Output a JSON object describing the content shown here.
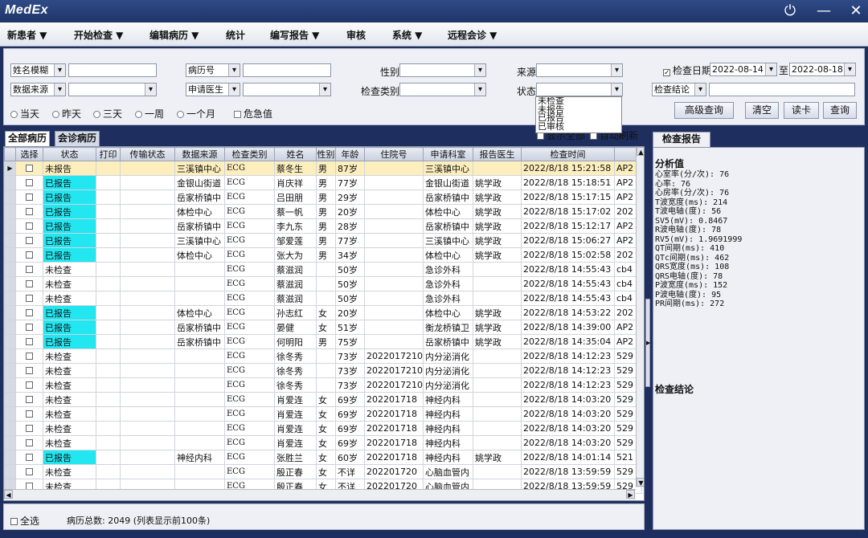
{
  "app": {
    "logo": "MedEx"
  },
  "window_controls": {
    "power": "⏻",
    "minimize": "—",
    "close": "✕"
  },
  "menu": [
    "新患者 ▼",
    "开始检查 ▼",
    "编辑病历 ▼",
    "统计",
    "编写报告 ▼",
    "审核",
    "系统 ▼",
    "远程会诊 ▼"
  ],
  "filters": {
    "name_mode": "姓名模糊",
    "record_no": "病历号",
    "gender": "性别",
    "source": "来源",
    "exam_date_label": "检查日期",
    "exam_date_checked": "✓",
    "date_from": "2022-08-14",
    "to": "至",
    "date_to": "2022-08-18",
    "data_source": "数据来源",
    "applying_doctor": "申请医生",
    "exam_type": "检查类别",
    "status": "状态",
    "conclusion": "检查结论",
    "ranges": [
      "当天",
      "昨天",
      "三天",
      "一周",
      "一个月"
    ],
    "critical": "危急值",
    "status_options": [
      "未检查",
      "未报告",
      "已报告",
      "已审核"
    ]
  },
  "buttons": {
    "advanced": "高级查询",
    "clear": "清空",
    "read_card": "读卡",
    "query": "查询"
  },
  "tabs": {
    "all": "全部病历",
    "consult": "会诊病历",
    "show_all": "显示全部",
    "auto_refresh": "自动刷新"
  },
  "columns": [
    "选择",
    "状态",
    "打印",
    "传输状态",
    "数据来源",
    "检查类别",
    "姓名",
    "性别",
    "年龄",
    "住院号",
    "申请科室",
    "报告医生",
    "检查时间",
    ""
  ],
  "rows": [
    [
      "未报告",
      "三溪镇中心",
      "ECG",
      "蔡冬生",
      "男",
      "87岁",
      "",
      "三溪镇中心",
      "",
      "2022/8/18 15:21:58",
      "AP2"
    ],
    [
      "已报告",
      "金银山街道",
      "ECG",
      "肖庆祥",
      "男",
      "77岁",
      "",
      "金银山街道",
      "姚学政",
      "2022/8/18 15:18:51",
      "AP2"
    ],
    [
      "已报告",
      "岳家桥镇中",
      "ECG",
      "吕田朋",
      "男",
      "29岁",
      "",
      "岳家桥镇中",
      "姚学政",
      "2022/8/18 15:17:15",
      "AP2"
    ],
    [
      "已报告",
      "体检中心",
      "ECG",
      "蔡一帆",
      "男",
      "20岁",
      "",
      "体检中心",
      "姚学政",
      "2022/8/18 15:17:02",
      "202"
    ],
    [
      "已报告",
      "岳家桥镇中",
      "ECG",
      "李九东",
      "男",
      "28岁",
      "",
      "岳家桥镇中",
      "姚学政",
      "2022/8/18 15:12:17",
      "AP2"
    ],
    [
      "已报告",
      "三溪镇中心",
      "ECG",
      "邹爱莲",
      "男",
      "77岁",
      "",
      "三溪镇中心",
      "姚学政",
      "2022/8/18 15:06:27",
      "AP2"
    ],
    [
      "已报告",
      "体检中心",
      "ECG",
      "张大为",
      "男",
      "34岁",
      "",
      "体检中心",
      "姚学政",
      "2022/8/18 15:02:58",
      "202"
    ],
    [
      "未检查",
      "",
      "ECG",
      "蔡滋润",
      "",
      "50岁",
      "",
      "急诊外科",
      "",
      "2022/8/18 14:55:43",
      "cb4"
    ],
    [
      "未检查",
      "",
      "ECG",
      "蔡滋润",
      "",
      "50岁",
      "",
      "急诊外科",
      "",
      "2022/8/18 14:55:43",
      "cb4"
    ],
    [
      "未检查",
      "",
      "ECG",
      "蔡滋润",
      "",
      "50岁",
      "",
      "急诊外科",
      "",
      "2022/8/18 14:55:43",
      "cb4"
    ],
    [
      "已报告",
      "体检中心",
      "ECG",
      "孙志红",
      "女",
      "20岁",
      "",
      "体检中心",
      "姚学政",
      "2022/8/18 14:53:22",
      "202"
    ],
    [
      "已报告",
      "岳家桥镇中",
      "ECG",
      "晏健",
      "女",
      "51岁",
      "",
      "衡龙桥镇卫",
      "姚学政",
      "2022/8/18 14:39:00",
      "AP2"
    ],
    [
      "已报告",
      "岳家桥镇中",
      "ECG",
      "何明阳",
      "男",
      "75岁",
      "",
      "岳家桥镇中",
      "姚学政",
      "2022/8/18 14:35:04",
      "AP2"
    ],
    [
      "未检查",
      "",
      "ECG",
      "徐冬秀",
      "",
      "73岁",
      "2022017210",
      "内分泌消化",
      "",
      "2022/8/18 14:12:23",
      "529"
    ],
    [
      "未检查",
      "",
      "ECG",
      "徐冬秀",
      "",
      "73岁",
      "2022017210",
      "内分泌消化",
      "",
      "2022/8/18 14:12:23",
      "529"
    ],
    [
      "未检查",
      "",
      "ECG",
      "徐冬秀",
      "",
      "73岁",
      "2022017210",
      "内分泌消化",
      "",
      "2022/8/18 14:12:23",
      "529"
    ],
    [
      "未检查",
      "",
      "ECG",
      "肖爱连",
      "女",
      "69岁",
      "202201718",
      "神经内科",
      "",
      "2022/8/18 14:03:20",
      "529"
    ],
    [
      "未检查",
      "",
      "ECG",
      "肖爱连",
      "女",
      "69岁",
      "202201718",
      "神经内科",
      "",
      "2022/8/18 14:03:20",
      "529"
    ],
    [
      "未检查",
      "",
      "ECG",
      "肖爱连",
      "女",
      "69岁",
      "202201718",
      "神经内科",
      "",
      "2022/8/18 14:03:20",
      "529"
    ],
    [
      "未检查",
      "",
      "ECG",
      "肖爱连",
      "女",
      "69岁",
      "202201718",
      "神经内科",
      "",
      "2022/8/18 14:03:20",
      "529"
    ],
    [
      "已报告",
      "神经内科",
      "ECG",
      "张胜兰",
      "女",
      "60岁",
      "202201718",
      "神经内科",
      "姚学政",
      "2022/8/18 14:01:14",
      "521"
    ],
    [
      "未检查",
      "",
      "ECG",
      "殷正春",
      "女",
      "不详",
      "202201720",
      "心脑血管内",
      "",
      "2022/8/18 13:59:59",
      "529"
    ],
    [
      "未检查",
      "",
      "ECG",
      "殷正春",
      "女",
      "不详",
      "202201720",
      "心脑血管内",
      "",
      "2022/8/18 13:59:59",
      "529"
    ]
  ],
  "status_bar": {
    "select_all": "全选",
    "total": "病历总数: 2049 (列表显示前100条)"
  },
  "report_panel": {
    "tab": "检查报告",
    "analysis_title": "分析值",
    "values": [
      "心室率(分/次): 76",
      "心率: 76",
      "心房率(分/次): 76",
      "T波宽度(ms): 214",
      "T波电轴(度): 56",
      "SV5(mV): 0.8467",
      "R波电轴(度): 78",
      "RV5(mV): 1.9691999",
      "QT间期(ms): 410",
      "QTc间期(ms): 462",
      "QRS宽度(ms): 108",
      "QRS电轴(度): 78",
      "P波宽度(ms): 152",
      "P波电轴(度): 95",
      "PR间期(ms): 272"
    ],
    "conclusion_title": "检查结论"
  },
  "colors": {
    "reported": "#22e6f0",
    "selected_row": "#fdeebd",
    "titlebar": "#1f3569"
  }
}
